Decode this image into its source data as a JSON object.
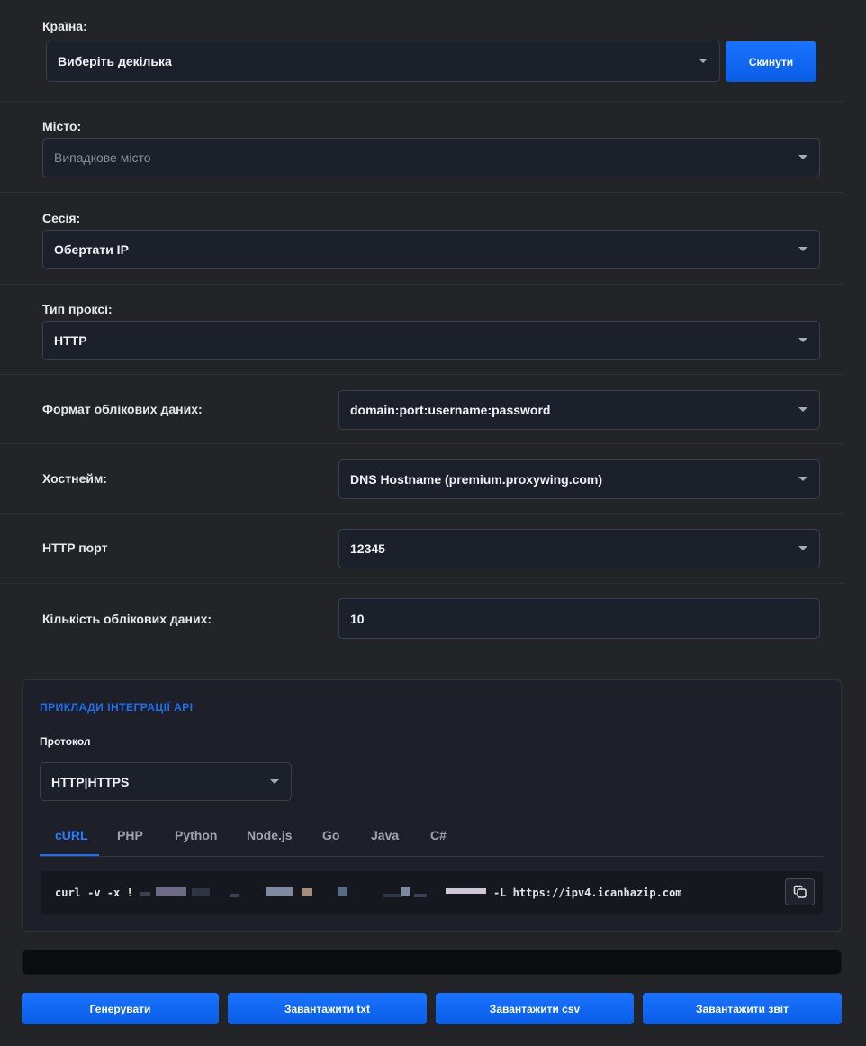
{
  "country": {
    "label": "Країна:",
    "value": "Виберіть декілька",
    "reset_label": "Скинути"
  },
  "city": {
    "label": "Місто:",
    "placeholder": "Випадкове місто"
  },
  "session": {
    "label": "Сесія:",
    "value": "Обертати IP"
  },
  "proxy_type": {
    "label": "Тип проксі:",
    "value": "HTTP"
  },
  "credentials_format": {
    "label": "Формат облікових даних:",
    "value": "domain:port:username:password"
  },
  "hostname": {
    "label": "Хостнейм:",
    "value": "DNS Hostname (premium.proxywing.com)"
  },
  "port": {
    "label": "HTTP порт",
    "value": "12345"
  },
  "credentials_count": {
    "label": "Кількість облікових даних:",
    "value": "10"
  },
  "api": {
    "title": "ПРИКЛАДИ ІНТЕГРАЦІЇ API",
    "protocol_label": "Протокол",
    "protocol_value": "HTTP|HTTPS",
    "tabs": [
      {
        "label": "cURL",
        "active": true
      },
      {
        "label": "PHP"
      },
      {
        "label": "Python"
      },
      {
        "label": "Node.js"
      },
      {
        "label": "Go"
      },
      {
        "label": "Java"
      },
      {
        "label": "C#"
      }
    ],
    "code_prefix": "curl -v -x !",
    "code_suffix": "-L https://ipv4.icanhazip.com"
  },
  "actions": {
    "generate": "Генерувати",
    "download_txt": "Завантажити txt",
    "download_csv": "Завантажити csv",
    "download_report": "Завантажити звіт"
  },
  "colors": {
    "accent": "#1a6ef7",
    "background": "#232427",
    "field": "#1c202a"
  }
}
